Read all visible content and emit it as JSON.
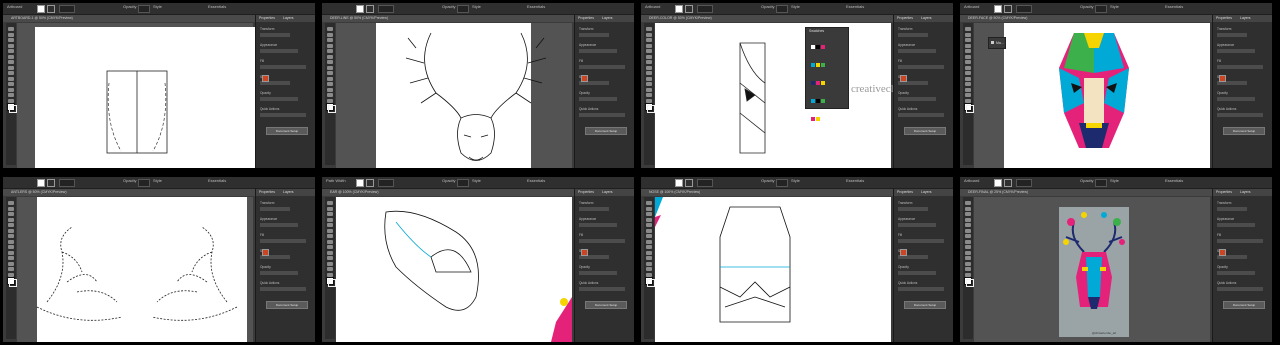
{
  "cells": [
    {
      "id": "p1",
      "app_label": "Artboard",
      "doc_tab": "ARTBOARD-1 @ 50% (CMYK/Preview)",
      "panel_tabs": [
        "Properties",
        "Layers"
      ],
      "panel_labels": [
        "Transform",
        "Appearance",
        "Fill",
        "Stroke",
        "Opacity",
        "Quick Actions"
      ],
      "panel_button": "Document Setup"
    },
    {
      "id": "p2",
      "app_label": "",
      "doc_tab": "DEER-LINE @ 50% (CMYK/Preview)",
      "panel_tabs": [
        "Properties",
        "Layers"
      ],
      "panel_labels": [
        "Transform",
        "Appearance",
        "Fill",
        "Stroke",
        "Opacity",
        "Quick Actions"
      ],
      "panel_button": "Document Setup"
    },
    {
      "id": "p3",
      "app_label": "Artboard",
      "doc_tab": "DEER-COLOR @ 50% (CMYK/Preview)",
      "panel_tabs": [
        "Properties",
        "Layers"
      ],
      "panel_labels": [
        "Transform",
        "Appearance",
        "Fill",
        "Stroke",
        "Opacity",
        "Quick Actions"
      ],
      "panel_button": "Document Setup",
      "float_panel_title": "Swatches",
      "watermark": "creativeclo"
    },
    {
      "id": "p4",
      "app_label": "Artboard",
      "doc_tab": "DEER-FACE @ 50% (CMYK/Preview)",
      "panel_tabs": [
        "Properties",
        "Layers"
      ],
      "panel_labels": [
        "Transform",
        "Appearance",
        "Fill",
        "Stroke",
        "Opacity",
        "Quick Actions"
      ],
      "panel_button": "Document Setup",
      "float_label": "Ma..."
    },
    {
      "id": "p5",
      "app_label": "",
      "doc_tab": "ANTLERS @ 50% (CMYK/Preview)",
      "panel_tabs": [
        "Properties",
        "Layers"
      ],
      "panel_labels": [
        "Transform",
        "Appearance",
        "Fill",
        "Stroke",
        "Opacity",
        "Quick Actions"
      ],
      "panel_button": "Document Setup"
    },
    {
      "id": "p6",
      "app_label": "Path Width",
      "doc_tab": "EAR @ 100% (CMYK/Preview)",
      "panel_tabs": [
        "Properties",
        "Layers"
      ],
      "panel_labels": [
        "Transform",
        "Appearance",
        "Fill",
        "Stroke",
        "Opacity",
        "Quick Actions"
      ],
      "panel_button": "Document Setup"
    },
    {
      "id": "p7",
      "app_label": "",
      "doc_tab": "NOSE @ 100% (CMYK/Preview)",
      "panel_tabs": [
        "Properties",
        "Layers"
      ],
      "panel_labels": [
        "Transform",
        "Appearance",
        "Fill",
        "Stroke",
        "Opacity",
        "Quick Actions"
      ],
      "panel_button": "Document Setup"
    },
    {
      "id": "p8",
      "app_label": "Artboard",
      "doc_tab": "DEER-FINAL @ 25% (CMYK/Preview)",
      "panel_tabs": [
        "Properties",
        "Layers"
      ],
      "panel_labels": [
        "Transform",
        "Appearance",
        "Fill",
        "Stroke",
        "Opacity",
        "Quick Actions"
      ],
      "panel_button": "Document Setup",
      "credit": "@chicazumbo_art"
    }
  ],
  "top_bar": {
    "opacity_label": "Opacity",
    "style_label": "Style",
    "essentials_label": "Essentials"
  },
  "colors": {
    "bg": "#000000",
    "ui_dark": "#2f2f2f",
    "canvas": "#535353",
    "pink": "#e4227a",
    "cyan": "#00a9d6",
    "yellow": "#f5d400",
    "navy": "#1e2a6e",
    "green": "#3cb04a"
  }
}
